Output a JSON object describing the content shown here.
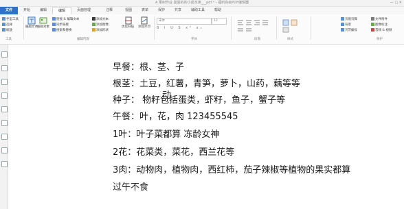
{
  "window": {
    "title": "A 果树作业 萱萱的的小话本读___pdf * - 福昕高级PDF编辑器",
    "controls": "— ▢ ✕"
  },
  "ribbon_tabs": [
    "文件",
    "开始",
    "编辑",
    "页面管理",
    "注释",
    "视图",
    "表单",
    "保护",
    "共享",
    "辅助工具",
    "帮助"
  ],
  "ribbon": {
    "tools_group": {
      "items": [
        "手型工具",
        "选择",
        "缩放"
      ],
      "label": "工具"
    },
    "edit_group": {
      "big1": "编辑文本",
      "big2": "编辑对象",
      "items": [
        "链接 & 编辑文本",
        "同步链接",
        "搜索和替换"
      ],
      "items2": [
        "添加文本",
        "添加图像",
        "添加形状"
      ],
      "big3": "优化扫描",
      "big4": "添加水印",
      "label": "编辑内容"
    },
    "font_group": {
      "font": "宋体",
      "size": "12",
      "format": "B I U S x² x₂",
      "label": "字体"
    },
    "para_group": {
      "label": "段落"
    },
    "style_group": {
      "label": "样式"
    },
    "right_group": {
      "items": [
        "页眉页脚",
        "背景",
        "贝茨编号"
      ],
      "items2": [
        "文件附件",
        "图像标注",
        "音频 & 视频"
      ],
      "label": "保护"
    }
  },
  "document": {
    "lines": [
      "早餐：根、茎、子",
      "根茎：土豆，红薯，青笋，萝卜，山药，藕等等",
      "种子：   物籽包括蛋类，虾籽，鱼子，蟹子等",
      "午餐：叶，花，肉     123455545",
      "1叶：叶子菜都算     冻龄女神",
      "2花：花菜类，菜花，西兰花等",
      "3肉：动物肉，植物肉，西红柿，茄子辣椒等植物的果实都算",
      "过午不食"
    ],
    "overlay_char": "动"
  }
}
